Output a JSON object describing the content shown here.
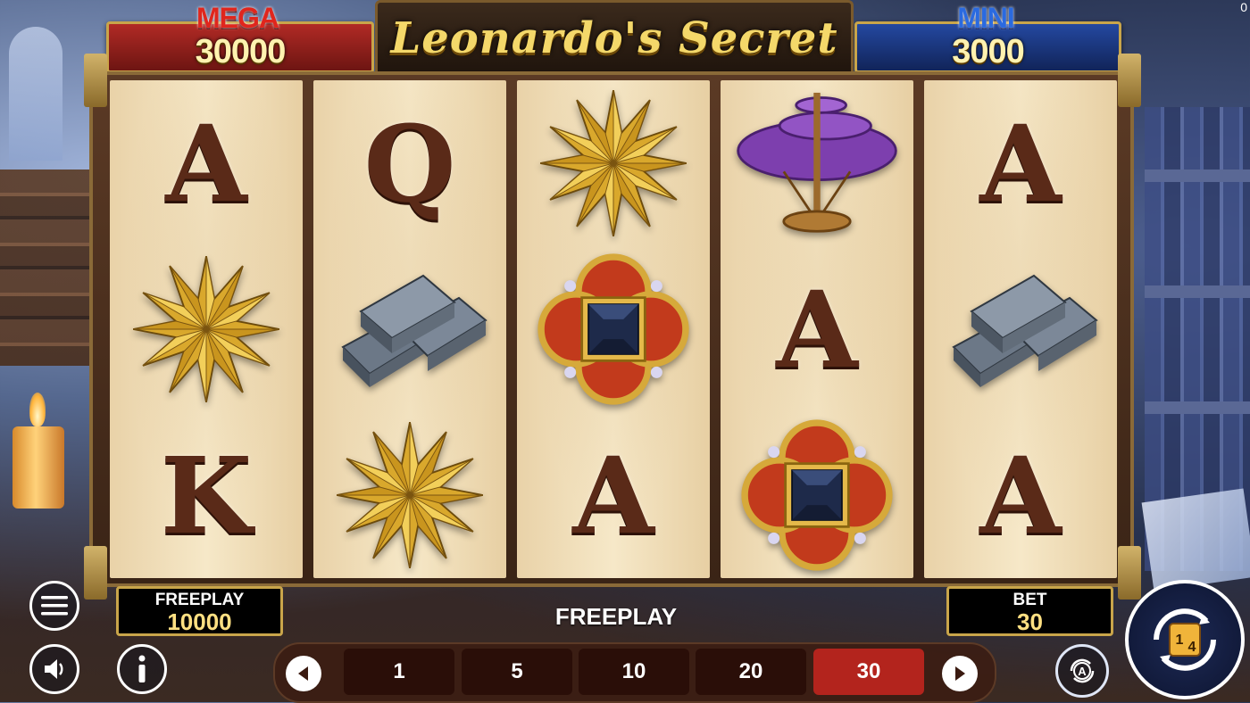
{
  "game": {
    "title": "Leonardo's Secret",
    "corner_counter": "0"
  },
  "jackpots": {
    "mega": {
      "label": "MEGA",
      "value": "30000"
    },
    "mini": {
      "label": "MINI",
      "value": "3000"
    }
  },
  "reels": [
    [
      "A",
      "star-dodecahedron",
      "K"
    ],
    [
      "Q",
      "iron-ingots",
      "star-dodecahedron"
    ],
    [
      "star-dodecahedron",
      "jeweled-medallion",
      "A"
    ],
    [
      "helicopter-machine",
      "A",
      "jeweled-medallion"
    ],
    [
      "A",
      "iron-ingots",
      "A"
    ]
  ],
  "balance": {
    "label": "FREEPLAY",
    "value": "10000"
  },
  "bet": {
    "label": "BET",
    "value": "30"
  },
  "status_text": "FREEPLAY",
  "bet_options": {
    "values": [
      "1",
      "5",
      "10",
      "20",
      "30"
    ],
    "selected": "30"
  },
  "icons": {
    "menu": "hamburger-icon",
    "sound": "speaker-icon",
    "info": "info-icon",
    "prev": "arrow-left-icon",
    "next": "arrow-right-icon",
    "autoplay": "autoplay-icon",
    "spin": "spin-icon"
  },
  "colors": {
    "mega": "#b12a25",
    "mini": "#2448a0",
    "gold": "#c9a54a",
    "selected_bet": "#b3241d"
  }
}
